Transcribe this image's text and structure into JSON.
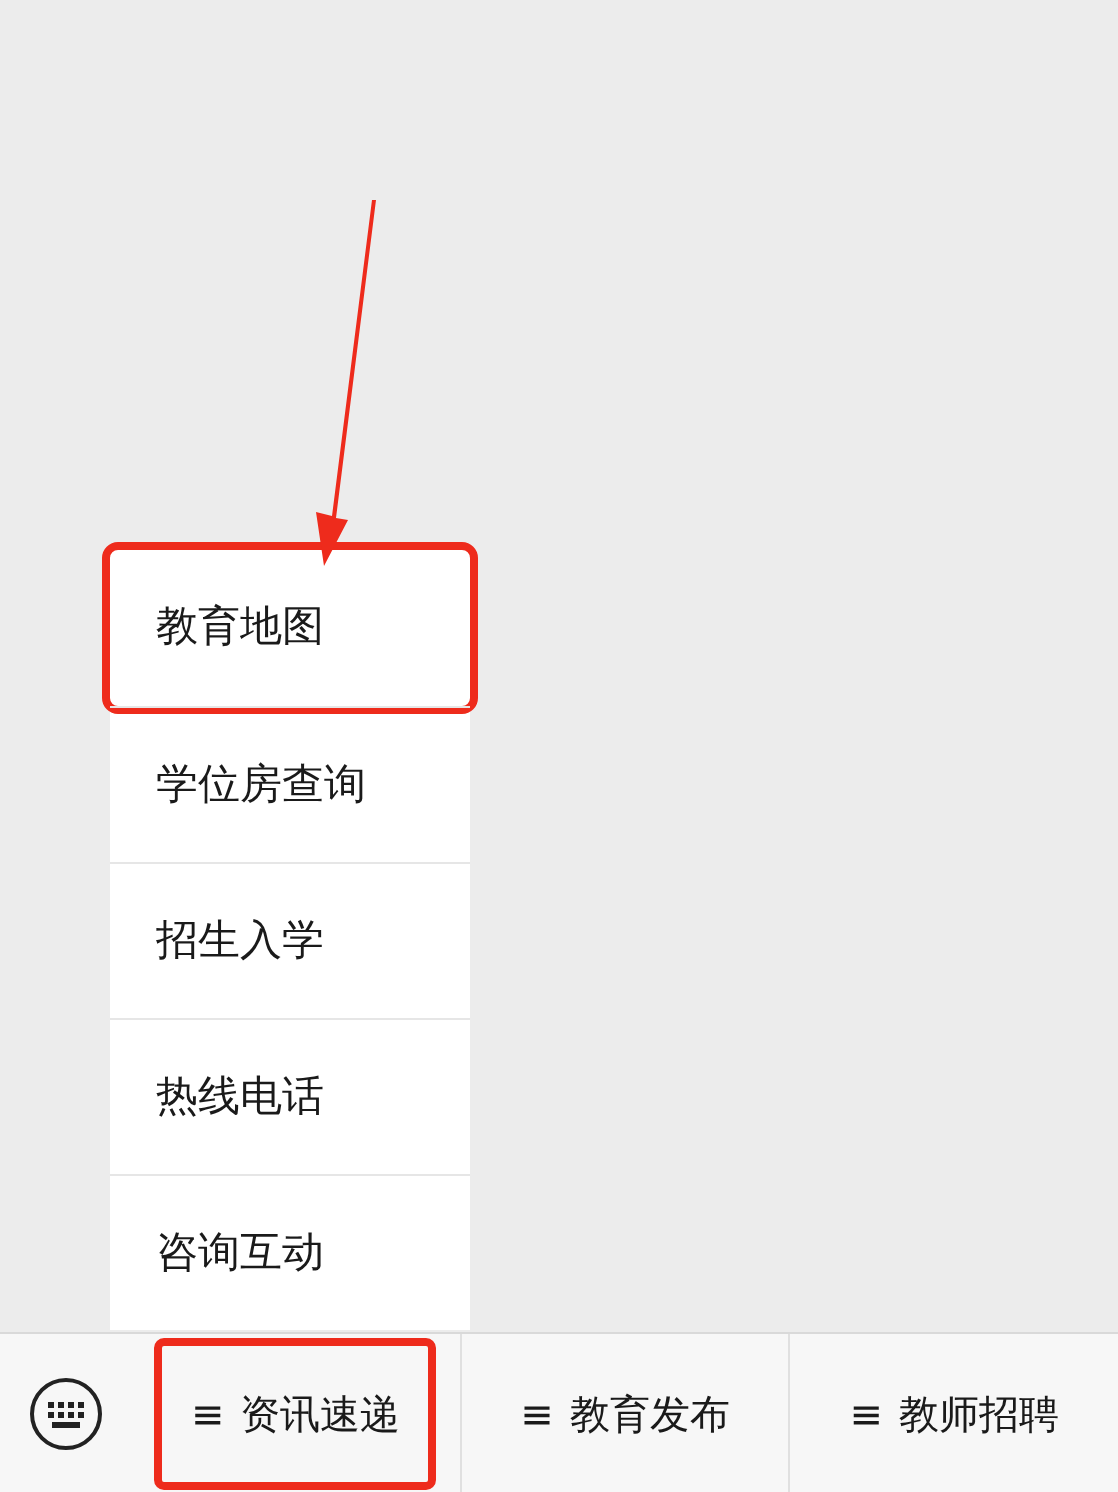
{
  "submenu": {
    "items": [
      {
        "label": "教育地图",
        "highlighted": true
      },
      {
        "label": "学位房查询",
        "highlighted": false
      },
      {
        "label": "招生入学",
        "highlighted": false
      },
      {
        "label": "热线电话",
        "highlighted": false
      },
      {
        "label": "咨询互动",
        "highlighted": false
      }
    ]
  },
  "menu_bar": {
    "buttons": [
      {
        "icon": "≡",
        "label": "资讯速递",
        "highlighted": true
      },
      {
        "icon": "≡",
        "label": "教育发布",
        "highlighted": false
      },
      {
        "icon": "≡",
        "label": "教师招聘",
        "highlighted": false
      }
    ]
  }
}
